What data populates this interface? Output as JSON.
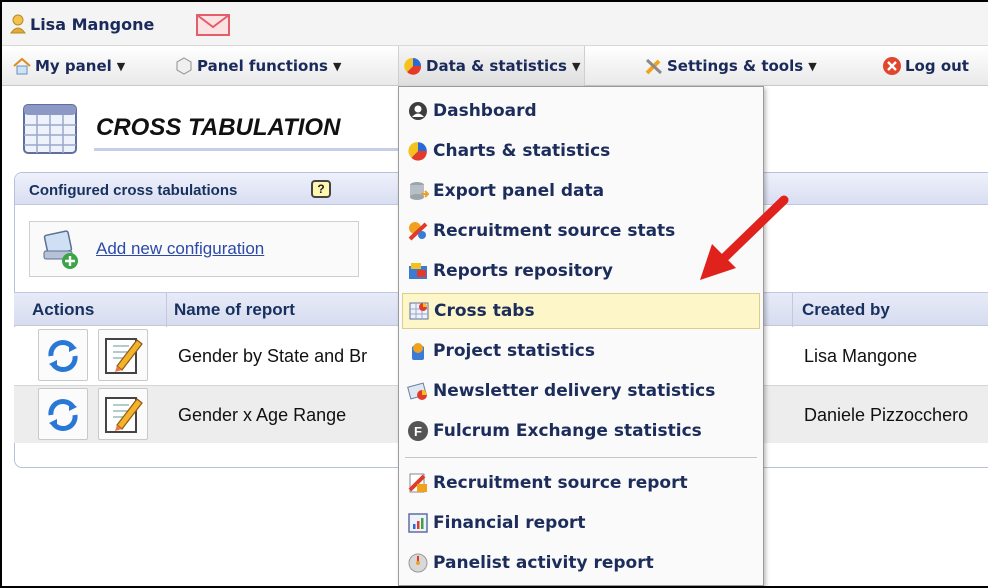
{
  "user": {
    "name": "Lisa Mangone"
  },
  "nav": {
    "my_panel": "My panel",
    "panel_functions": "Panel functions",
    "data_statistics": "Data & statistics",
    "settings_tools": "Settings & tools",
    "log_out": "Log out"
  },
  "page": {
    "title": "CROSS TABULATION"
  },
  "panel": {
    "title": "Configured cross tabulations",
    "help": "?",
    "add_link": "Add new configuration"
  },
  "table": {
    "headers": {
      "actions": "Actions",
      "name": "Name of report",
      "created_by": "Created by"
    },
    "rows": [
      {
        "name": "Gender by State and Br",
        "created_by": "Lisa Mangone"
      },
      {
        "name": "Gender x Age Range",
        "created_by": "Daniele Pizzocchero"
      }
    ]
  },
  "menu": {
    "items": [
      {
        "label": "Dashboard",
        "icon": "dashboard-icon"
      },
      {
        "label": "Charts & statistics",
        "icon": "charts-icon"
      },
      {
        "label": "Export panel data",
        "icon": "database-export-icon"
      },
      {
        "label": "Recruitment source stats",
        "icon": "recruitment-stats-icon"
      },
      {
        "label": "Reports repository",
        "icon": "reports-repository-icon"
      },
      {
        "label": "Cross tabs",
        "icon": "cross-tabs-icon"
      },
      {
        "label": "Project statistics",
        "icon": "project-statistics-icon"
      },
      {
        "label": "Newsletter delivery statistics",
        "icon": "newsletter-icon"
      },
      {
        "label": "Fulcrum Exchange statistics",
        "icon": "fulcrum-icon"
      },
      {
        "label": "Recruitment source report",
        "icon": "recruitment-report-icon"
      },
      {
        "label": "Financial report",
        "icon": "financial-report-icon"
      },
      {
        "label": "Panelist activity report",
        "icon": "panelist-activity-icon"
      }
    ],
    "highlighted": "Cross tabs"
  },
  "colors": {
    "nav_text": "#1a2a5a",
    "highlight": "#fdf6c8",
    "arrow": "#e0221c",
    "link": "#2b4aa8"
  }
}
